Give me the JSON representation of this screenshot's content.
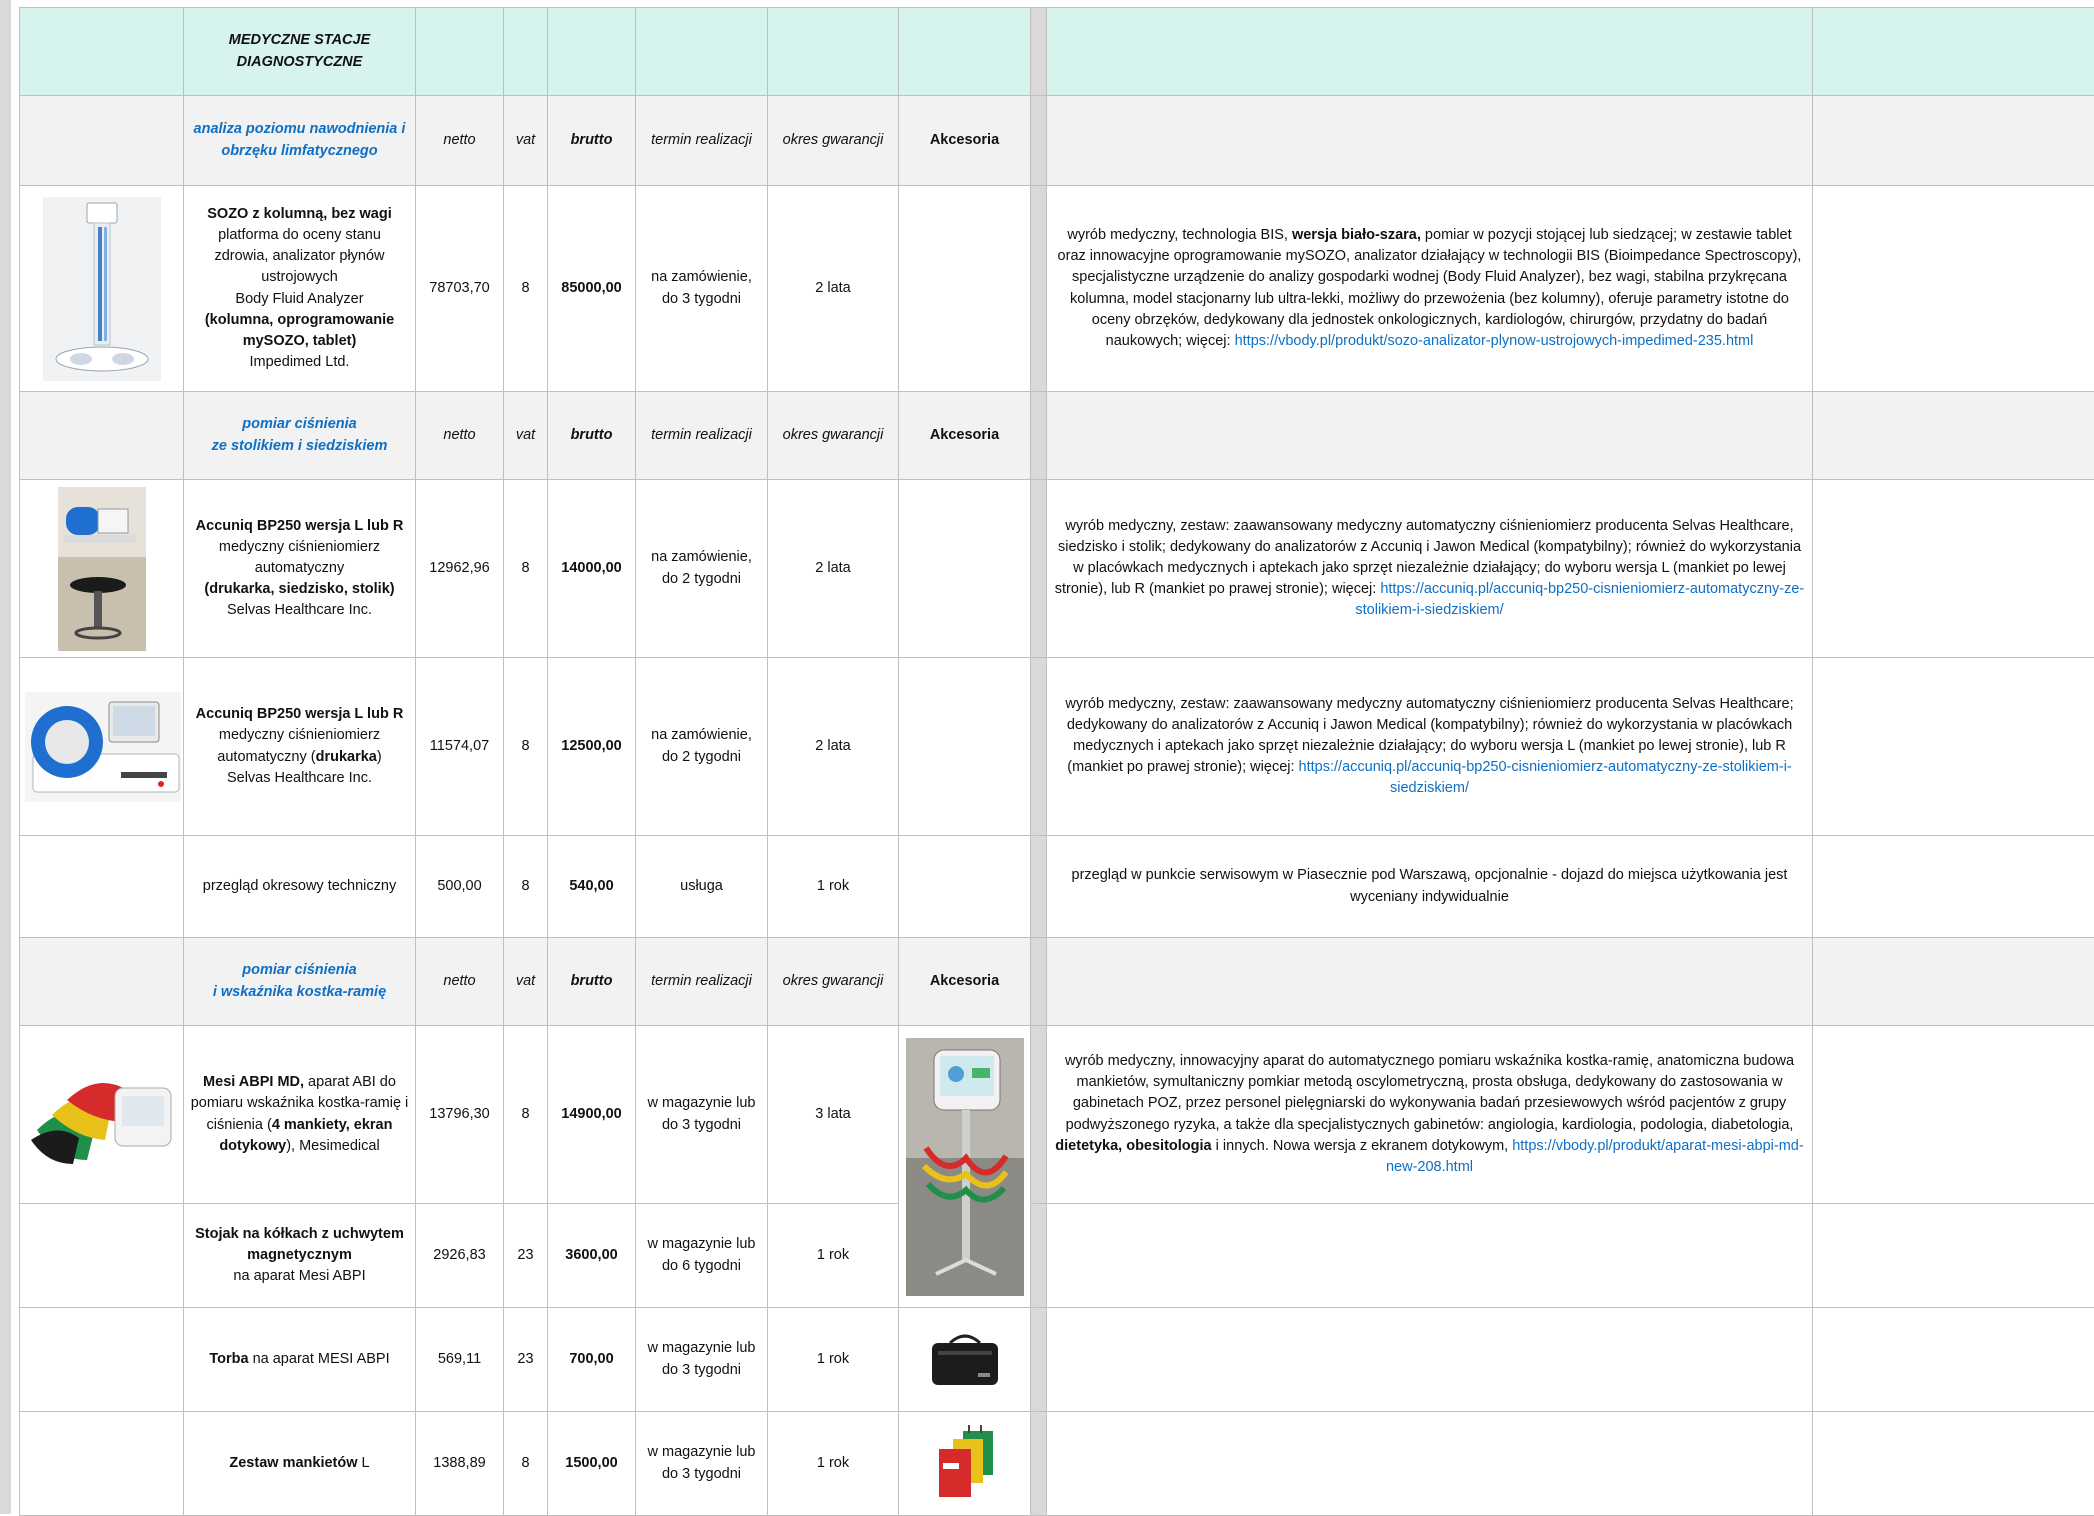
{
  "sheet_title": [
    "MEDYCZNE STACJE",
    "DIAGNOSTYCZNE"
  ],
  "headers": {
    "netto": "netto",
    "vat": "vat",
    "brutto": "brutto",
    "termin": "termin realizacji",
    "gwarancja": "okres gwarancji",
    "akcesoria": "Akcesoria"
  },
  "sections": [
    {
      "title": [
        "analiza poziomu nawodnienia i",
        "obrzęku limfatycznego"
      ],
      "items": [
        {
          "name": [
            "SOZO z kolumną, bez wagi",
            "platforma do oceny stanu",
            "zdrowia, analizator płynów",
            "ustrojowych",
            "Body Fluid Analyzer",
            "(",
            "kolumna, oprogramowanie mySOZO, tablet",
            ")",
            "Impedimed Ltd."
          ],
          "netto": "78703,70",
          "vat": "8",
          "brutto": "85000,00",
          "termin": [
            "na zamówienie,",
            "do 3 tygodni"
          ],
          "gwarancja": "2 lata",
          "desc": {
            "pre": "wyrób medyczny, technologia BIS, ",
            "bold": "wersja biało-szara,",
            "post": " pomiar w pozycji stojącej lub siedzącej; w zestawie tablet oraz innowacyjne oprogramowanie mySOZO, analizator działający w technologii BIS (Bioimpedance Spectroscopy), specjalistyczne urządzenie do analizy gospodarki wodnej (Body Fluid Analyzer), bez wagi, stabilna przykręcana kolumna, model stacjonarny lub ultra-lekki, możliwy do przewożenia (bez kolumny), oferuje parametry istotne do oceny obrzęków, dedykowany dla jednostek onkologicznych, kardiologów, chirurgów, przydatny do badań naukowych; więcej: ",
            "link": "https://vbody.pl/produkt/sozo-analizator-plynow-ustrojowych-impedimed-235.html"
          }
        }
      ]
    },
    {
      "title": [
        "pomiar ciśnienia",
        "ze stolikiem i siedziskiem"
      ],
      "items": [
        {
          "name": [
            "Accuniq BP250 wersja L lub R",
            "medyczny ciśnieniomierz",
            "automatyczny",
            "(",
            "drukarka, siedzisko, stolik",
            ")",
            "Selvas Healthcare Inc."
          ],
          "netto": "12962,96",
          "vat": "8",
          "brutto": "14000,00",
          "termin": [
            "na zamówienie,",
            "do 2 tygodni"
          ],
          "gwarancja": "2 lata",
          "desc": {
            "pre": "wyrób medyczny, zestaw: zaawansowany medyczny automatyczny ciśnieniomierz producenta Selvas Healthcare, siedzisko i stolik; dedykowany do analizatorów z Accuniq i Jawon Medical (kompatybilny); również do wykorzystania w placówkach medycznych i aptekach jako sprzęt niezależnie działający; do wyboru wersja L (mankiet po lewej stronie), lub R (mankiet po prawej stronie); więcej: ",
            "link": "https://accuniq.pl/accuniq-bp250-cisnieniomierz-automatyczny-ze-stolikiem-i-siedziskiem/"
          }
        },
        {
          "name": [
            "Accuniq BP250 wersja L lub R",
            "medyczny ciśnieniomierz",
            "automatyczny (",
            "drukarka",
            ")",
            "Selvas Healthcare Inc."
          ],
          "netto": "11574,07",
          "vat": "8",
          "brutto": "12500,00",
          "termin": [
            "na zamówienie,",
            "do 2 tygodni"
          ],
          "gwarancja": "2 lata",
          "desc": {
            "pre": "wyrób medyczny, zestaw: zaawansowany medyczny automatyczny ciśnieniomierz producenta Selvas Healthcare; dedykowany do analizatorów z Accuniq i Jawon Medical (kompatybilny); również do wykorzystania w placówkach medycznych i aptekach jako sprzęt niezależnie działający; do wyboru wersja L (mankiet po lewej stronie), lub R (mankiet po prawej stronie); więcej: ",
            "link": "https://accuniq.pl/accuniq-bp250-cisnieniomierz-automatyczny-ze-stolikiem-i-siedziskiem/"
          }
        },
        {
          "name": [
            "przegląd okresowy techniczny"
          ],
          "netto": "500,00",
          "vat": "8",
          "brutto": "540,00",
          "termin": [
            "usługa"
          ],
          "gwarancja": "1 rok",
          "desc": {
            "pre": "przegląd w punkcie serwisowym w Piasecznie pod Warszawą, opcjonalnie - dojazd do miejsca użytkowania jest wyceniany indywidualnie"
          }
        }
      ]
    },
    {
      "title": [
        "pomiar ciśnienia",
        "i wskaźnika kostka-ramię"
      ],
      "items": [
        {
          "name": [
            "Mesi ABPI MD,",
            " aparat ABI do pomiaru wskaźnika kostka-ramię i ciśnienia (",
            "4 mankiety, ekran dotykowy",
            "), Mesimedical"
          ],
          "netto": "13796,30",
          "vat": "8",
          "brutto": "14900,00",
          "termin": [
            "w magazynie lub",
            "do 3 tygodni"
          ],
          "gwarancja": "3 lata",
          "desc": {
            "pre": "wyrób medyczny, innowacyjny aparat do automatycznego pomiaru wskaźnika kostka-ramię, anatomiczna budowa mankietów, symultaniczny pomkiar metodą oscylometryczną, prosta obsługa, dedykowany do zastosowania w gabinetach POZ, przez personel pielęgniarski do wykonywania badań przesiewowych wśród pacjentów z grupy podwyższonego ryzyka, a także dla specjalistycznych gabinetów: angiologia, kardiologia, podologia, diabetologia, ",
            "bold": "dietetyka, obesitologia",
            "post": "  i innych. Nowa wersja z ekranem dotykowym, ",
            "link": "https://vbody.pl/produkt/aparat-mesi-abpi-md-new-208.html"
          }
        },
        {
          "name": [
            "Stojak na kółkach z uchwytem magnetycznym",
            "na aparat Mesi ABPI"
          ],
          "netto": "2926,83",
          "vat": "23",
          "brutto": "3600,00",
          "termin": [
            "w magazynie lub",
            "do 6 tygodni"
          ],
          "gwarancja": "1 rok"
        },
        {
          "name": [
            "Torba",
            " na aparat MESI ABPI"
          ],
          "netto": "569,11",
          "vat": "23",
          "brutto": "700,00",
          "termin": [
            "w magazynie lub",
            "do 3 tygodni"
          ],
          "gwarancja": "1 rok"
        },
        {
          "name": [
            "Zestaw mankietów",
            " L"
          ],
          "netto": "1388,89",
          "vat": "8",
          "brutto": "1500,00",
          "termin": [
            "w magazynie lub",
            "do 3 tygodni"
          ],
          "gwarancja": "1 rok"
        }
      ]
    }
  ],
  "colors": {
    "header_fill": "#d6f3ee",
    "section_fill": "#f2f2f2",
    "section_title": "#0f6fc4",
    "link": "#0f6fc4",
    "grid": "#bfbfbf"
  },
  "icons": [
    "sozo-device-photo",
    "accuniq-bp250-stand-photo",
    "accuniq-bp250-photo",
    "mesi-abpi-cuffs-photo",
    "mesi-abpi-stand-photo",
    "mesi-bag-photo",
    "mesi-cuff-set-photo"
  ]
}
